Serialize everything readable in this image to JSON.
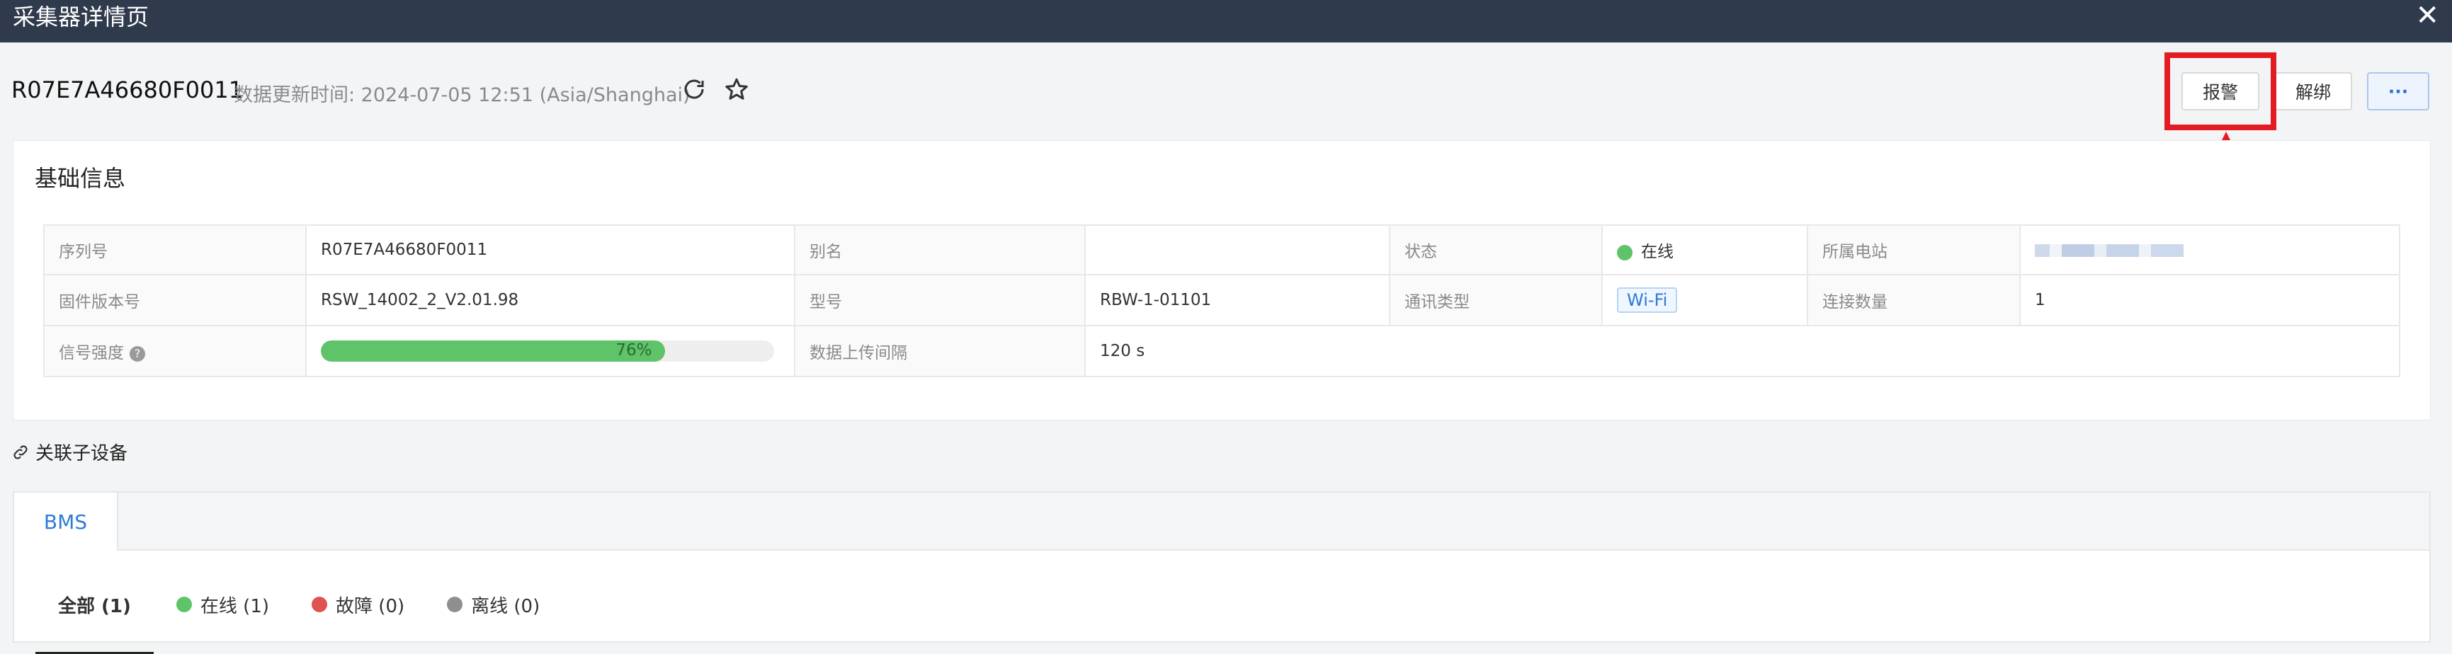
{
  "window": {
    "title": "采集器详情页"
  },
  "header": {
    "serial": "R07E7A46680F0011",
    "updated": "数据更新时间: 2024-07-05 12:51 (Asia/Shanghai)",
    "buttons": {
      "alarm": "报警",
      "unbind": "解绑",
      "more": "···"
    }
  },
  "basic": {
    "title": "基础信息",
    "rows": [
      [
        {
          "label": "序列号",
          "value": "R07E7A46680F0011"
        },
        {
          "label": "别名",
          "value": ""
        },
        {
          "label": "状态",
          "value": "在线"
        },
        {
          "label": "所属电站",
          "value": ""
        }
      ],
      [
        {
          "label": "固件版本号",
          "value": "RSW_14002_2_V2.01.98"
        },
        {
          "label": "型号",
          "value": "RBW-1-01101"
        },
        {
          "label": "通讯类型",
          "value": "Wi-Fi"
        },
        {
          "label": "连接数量",
          "value": "1"
        }
      ],
      [
        {
          "label": "信号强度",
          "value": "76%",
          "progress": 0.76
        },
        {
          "label": "数据上传间隔",
          "value": "120 s"
        }
      ]
    ]
  },
  "sub_devices": {
    "title": "关联子设备",
    "tab": "BMS",
    "filters": [
      {
        "label": "全部 (1)"
      },
      {
        "label": "在线 (1)",
        "color": "#5fc36a"
      },
      {
        "label": "故障 (0)",
        "color": "#e05252"
      },
      {
        "label": "离线 (0)",
        "color": "#8f8f8f"
      }
    ]
  },
  "colors": {
    "online": "#5fc36a",
    "accent": "#2e7bd6",
    "highlight": "#e31b23"
  }
}
